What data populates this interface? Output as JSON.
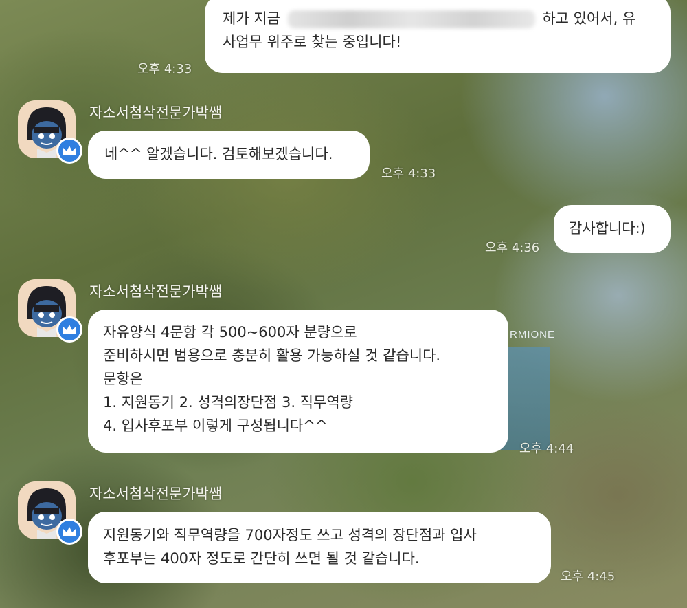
{
  "messages": [
    {
      "id": "m1",
      "direction": "outgoing",
      "lines": [
        "제가 지금 ",
        " 하고 있어서, 유",
        "사업무 위주로 찾는 중입니다!"
      ],
      "has_redaction": true,
      "time": "오후 4:33"
    },
    {
      "id": "m2",
      "direction": "incoming",
      "sender": "자소서첨삭전문가박쌤",
      "lines": [
        "네^^ 알겠습니다. 검토해보겠습니다."
      ],
      "time": "오후 4:33"
    },
    {
      "id": "m3",
      "direction": "outgoing",
      "lines": [
        "감사합니다:)"
      ],
      "time": "오후 4:36"
    },
    {
      "id": "m4",
      "direction": "incoming",
      "sender": "자소서첨삭전문가박쌤",
      "lines": [
        "자유양식 4문항 각 500~600자 분량으로",
        "준비하시면 범용으로 충분히 활용 가능하실 것 같습니다.",
        "문항은",
        "1. 지원동기 2. 성격의장단점 3. 직무역량",
        "4. 입사후포부 이렇게 구성됩니다^^"
      ],
      "time": "오후 4:44"
    },
    {
      "id": "m5",
      "direction": "incoming",
      "sender": "자소서첨삭전문가박쌤",
      "lines": [
        "지원동기와 직무역량을 700자정도 쓰고 성격의 장단점과 입사",
        "후포부는 400자 정도로 간단히 쓰면 될 것 같습니다."
      ],
      "time": "오후 4:45"
    }
  ],
  "background_text": "RMIONE",
  "icons": {
    "avatar": "character-avatar-icon",
    "badge": "crown-badge-icon"
  },
  "colors": {
    "bubble": "#ffffff",
    "badge": "#2f7fe0",
    "text": "#2a2a2a"
  }
}
